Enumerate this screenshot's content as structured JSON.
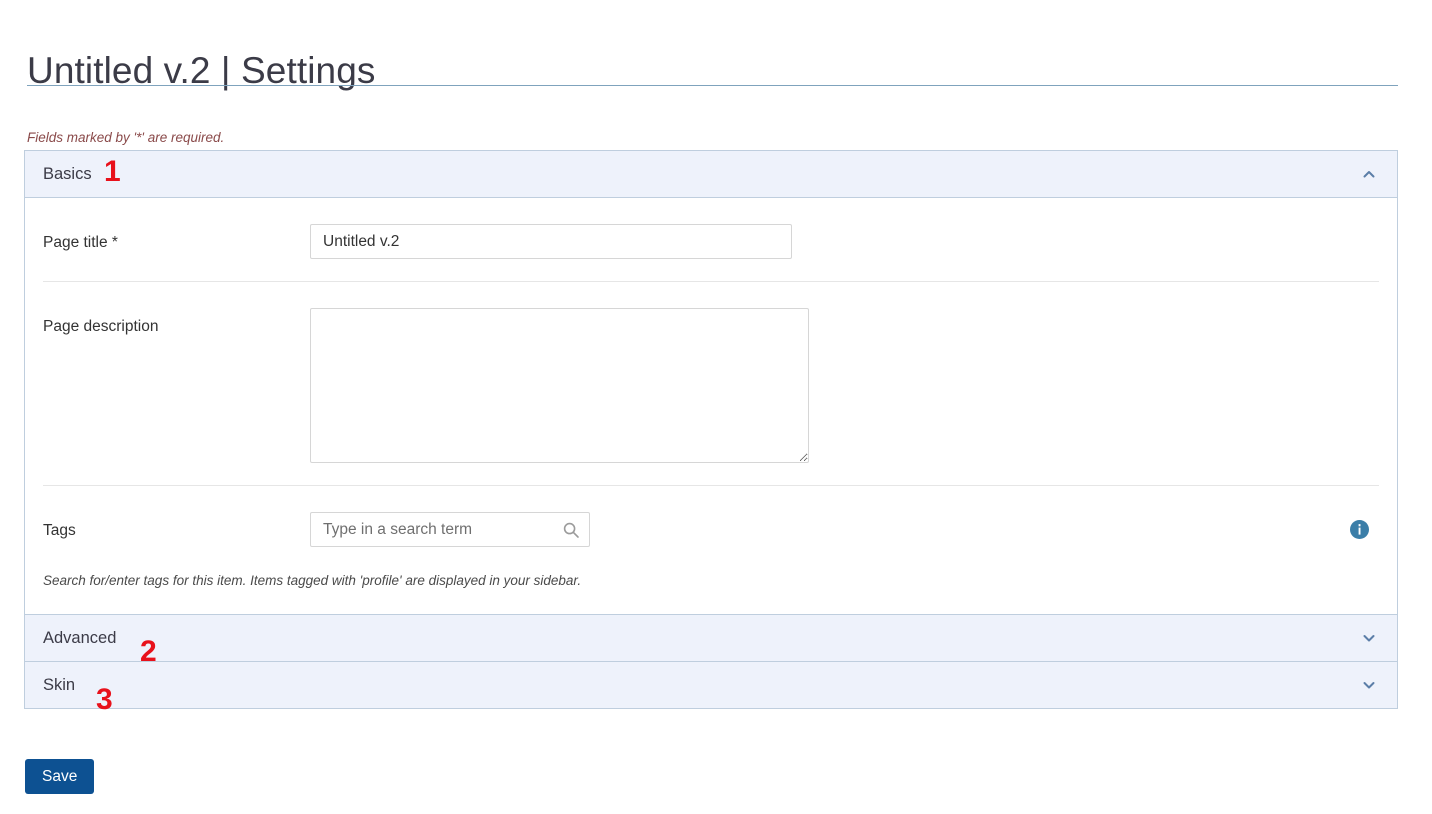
{
  "page": {
    "title": "Untitled v.2 | Settings",
    "required_note": "Fields marked by '*' are required."
  },
  "accordion": {
    "sections": [
      {
        "id": "basics",
        "label": "Basics",
        "expanded": true,
        "chevron": "chevron-up-icon",
        "annotation": "1"
      },
      {
        "id": "advanced",
        "label": "Advanced",
        "expanded": false,
        "chevron": "chevron-down-icon",
        "annotation": "2"
      },
      {
        "id": "skin",
        "label": "Skin",
        "expanded": false,
        "chevron": "chevron-down-icon",
        "annotation": "3"
      }
    ]
  },
  "basics": {
    "page_title": {
      "label": "Page title *",
      "value": "Untitled v.2",
      "placeholder": ""
    },
    "page_description": {
      "label": "Page description",
      "value": "",
      "placeholder": ""
    },
    "tags": {
      "label": "Tags",
      "value": "",
      "placeholder": "Type in a search term",
      "search_icon": "search-icon",
      "info_icon": "info-icon",
      "help_text": "Search for/enter tags for this item. Items tagged with 'profile' are displayed in your sidebar."
    }
  },
  "footer": {
    "save_label": "Save"
  },
  "colors": {
    "accent_rule": "#7fa3bd",
    "panel_header_bg": "#eef2fb",
    "panel_border": "#bfcede",
    "chevron": "#5b7ea8",
    "info_icon": "#3b7ea8",
    "save_button_bg": "#0d5192",
    "required_note": "#8a4a4a",
    "annotation": "#e8111b"
  }
}
